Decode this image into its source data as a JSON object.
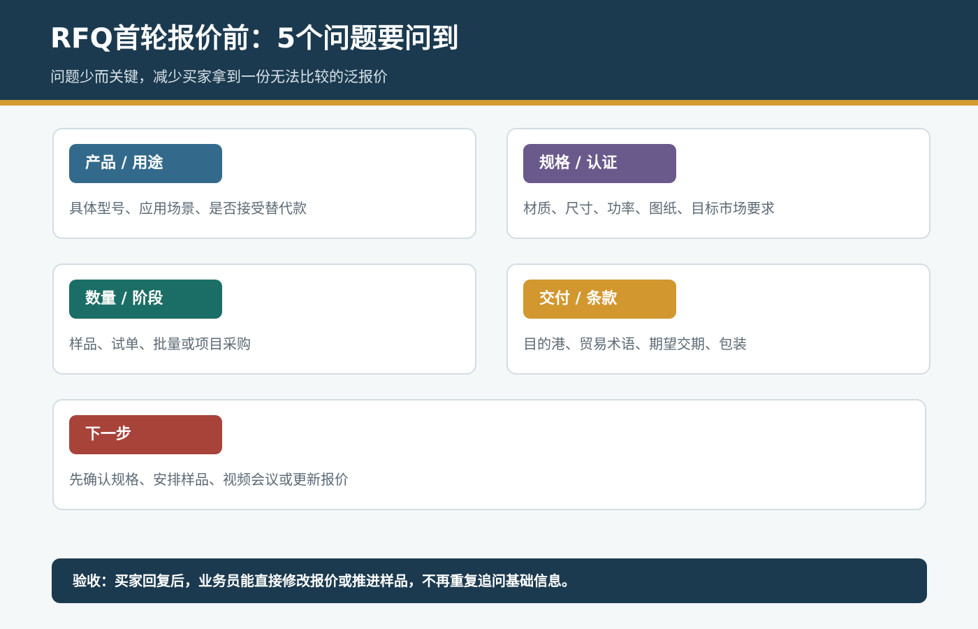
{
  "header": {
    "title": "RFQ首轮报价前：5个问题要问到",
    "subtitle": "问题少而关键，减少买家拿到一份无法比较的泛报价"
  },
  "cards": [
    {
      "label": "产品 / 用途",
      "text": "具体型号、应用场景、是否接受替代款",
      "color": "#336a8c"
    },
    {
      "label": "规格 / 认证",
      "text": "材质、尺寸、功率、图纸、目标市场要求",
      "color": "#6a5a8c"
    },
    {
      "label": "数量 / 阶段",
      "text": "样品、试单、批量或项目采购",
      "color": "#1b6e65"
    },
    {
      "label": "交付 / 条款",
      "text": "目的港、贸易术语、期望交期、包装",
      "color": "#d2972e"
    },
    {
      "label": "下一步",
      "text": "先确认规格、安排样品、视频会议或更新报价",
      "color": "#a8433a"
    }
  ],
  "footer": {
    "text": "验收：买家回复后，业务员能直接修改报价或推进样品，不再重复追问基础信息。"
  },
  "colors": {
    "header_bg": "#1b3a4f",
    "accent_rule": "#d49b33",
    "page_bg": "#f5f8f9"
  }
}
